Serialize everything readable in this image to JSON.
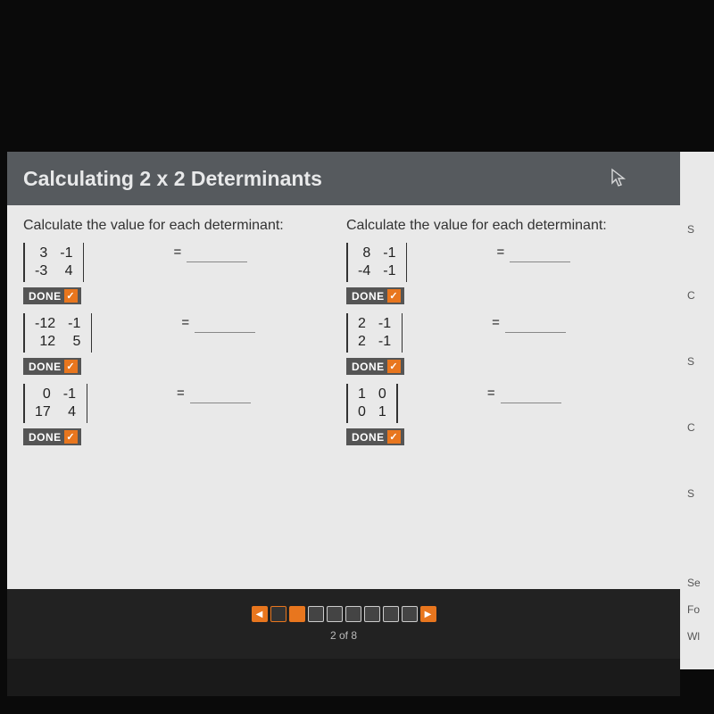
{
  "header": {
    "title": "Calculating 2 x 2 Determinants"
  },
  "columns": {
    "left": {
      "prompt": "Calculate the value for each determinant:",
      "problems": [
        {
          "r1c1": "3",
          "r1c2": "-1",
          "r2c1": "-3",
          "r2c2": "4",
          "answer": ""
        },
        {
          "r1c1": "-12",
          "r1c2": "-1",
          "r2c1": "12",
          "r2c2": "5",
          "answer": ""
        },
        {
          "r1c1": "0",
          "r1c2": "-1",
          "r2c1": "17",
          "r2c2": "4",
          "answer": ""
        }
      ]
    },
    "right": {
      "prompt": "Calculate the value for each determinant:",
      "problems": [
        {
          "r1c1": "8",
          "r1c2": "-1",
          "r2c1": "-4",
          "r2c2": "-1",
          "answer": ""
        },
        {
          "r1c1": "2",
          "r1c2": "-1",
          "r2c1": "2",
          "r2c2": "-1",
          "answer": ""
        },
        {
          "r1c1": "1",
          "r1c2": "0",
          "r2c1": "0",
          "r2c2": "1",
          "answer": ""
        }
      ]
    }
  },
  "done_label": "DONE",
  "equals_symbol": "=",
  "check_symbol": "✓",
  "footer": {
    "page_label": "2 of 8",
    "total_pages": 8,
    "current_page": 2
  },
  "nav": {
    "prev_symbol": "◀",
    "next_symbol": "▶"
  },
  "side_hints": {
    "t1": "S",
    "t2": "C",
    "t3": "S",
    "t4": "C",
    "t5": "S",
    "t6": "Se",
    "t7": "Fo",
    "t8": "Wl"
  }
}
